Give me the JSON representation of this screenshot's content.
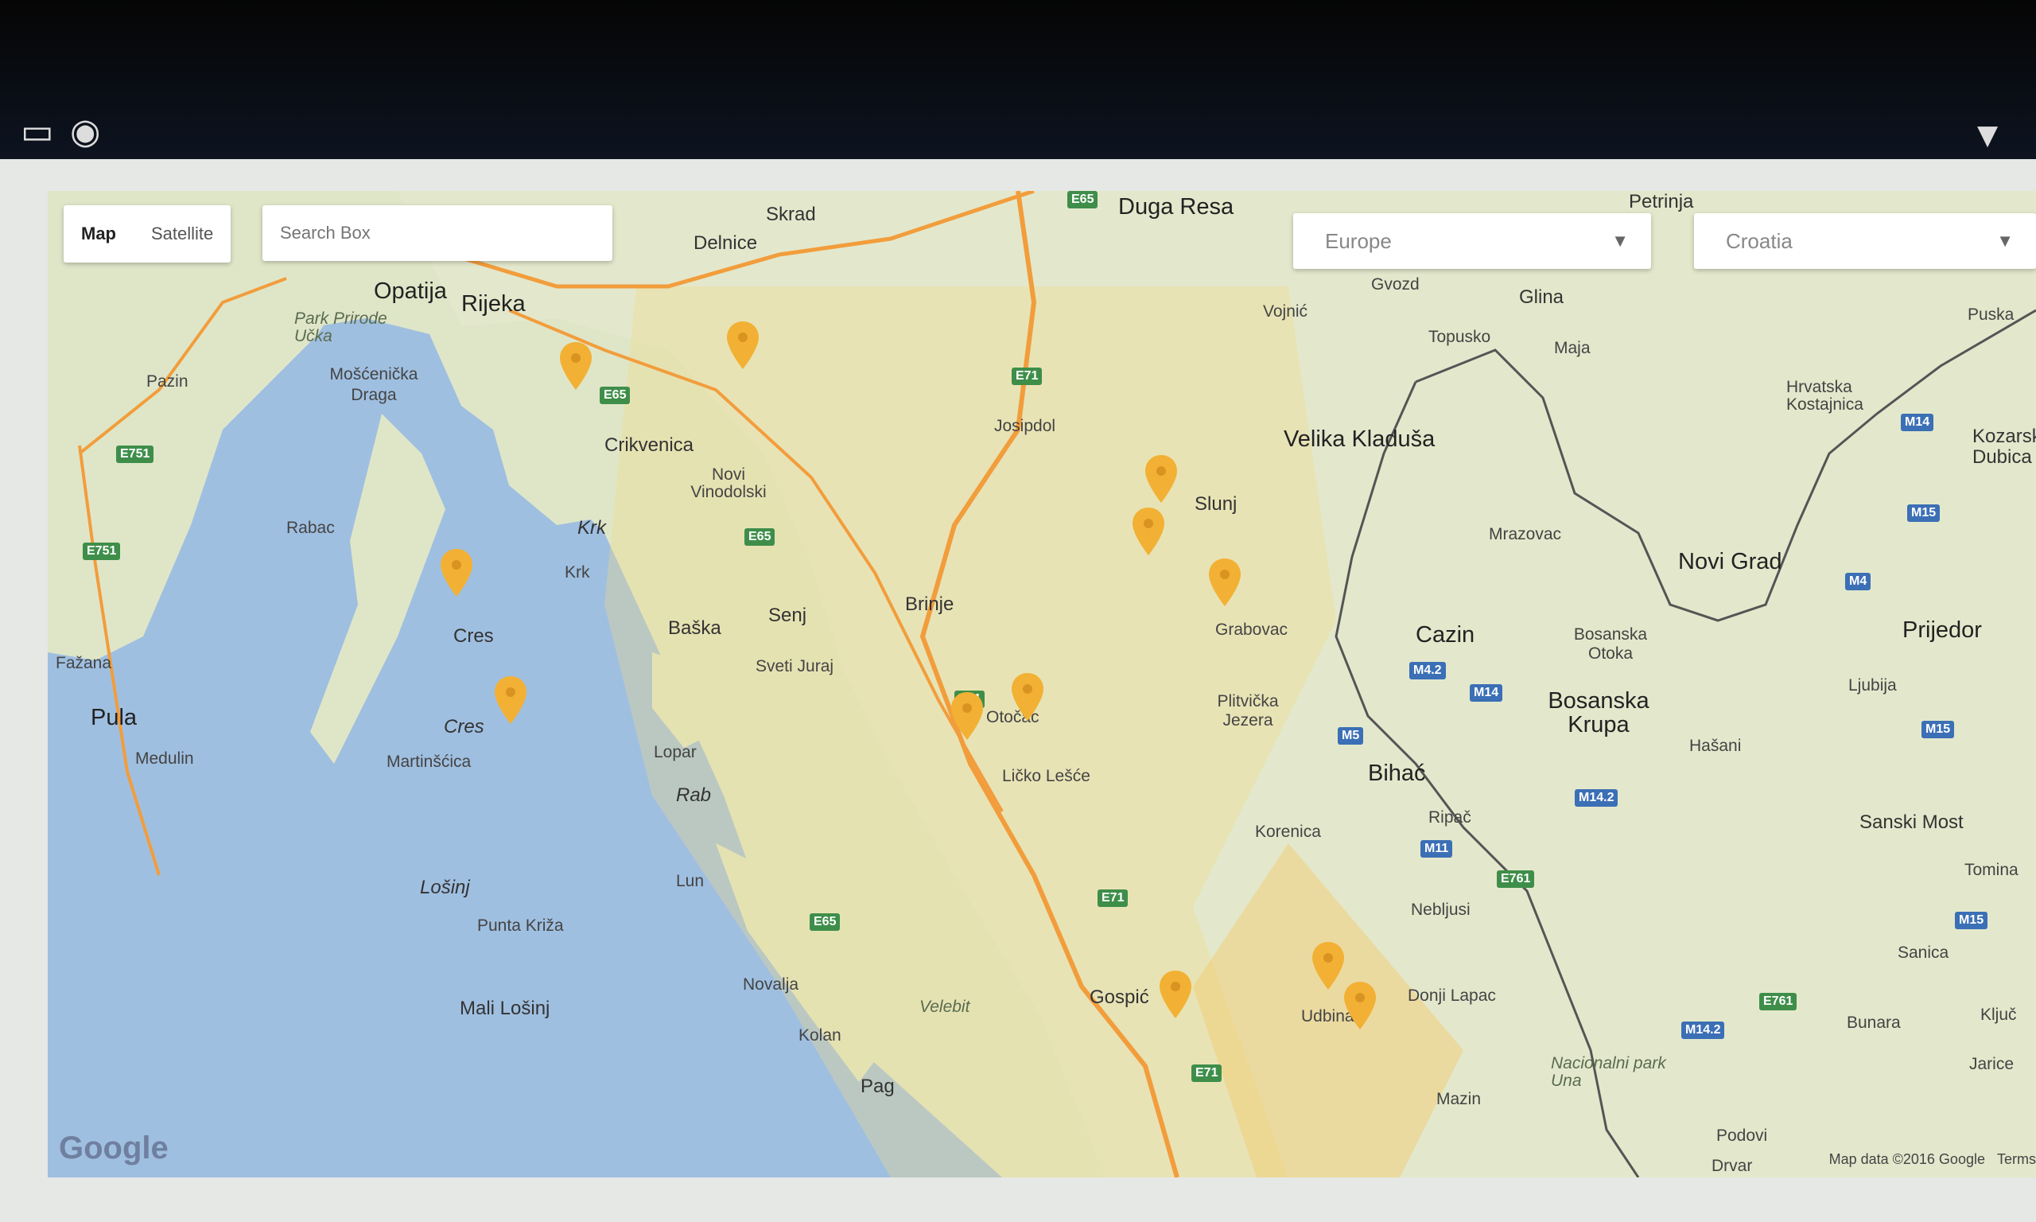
{
  "map_controls": {
    "map_tab": "Map",
    "satellite_tab": "Satellite",
    "search_placeholder": "Search Box",
    "region_select": "Europe",
    "country_select": "Croatia"
  },
  "attribution": {
    "google": "Google",
    "map_data": "Map data ©2016 Google",
    "terms": "Terms"
  },
  "places": {
    "skrad": "Skrad",
    "duga_resa": "Duga Resa",
    "petrinja": "Petrinja",
    "delnice": "Delnice",
    "opatija": "Opatija",
    "rijeka": "Rijeka",
    "park_ucka": "Park Prirode Učka",
    "moscenicka": "Mošćenička Draga",
    "gvozd": "Gvozd",
    "glina": "Glina",
    "vojnic": "Vojnić",
    "topusko": "Topusko",
    "maja": "Maja",
    "puska": "Puska",
    "pazin": "Pazin",
    "josipdol": "Josipdol",
    "hrvatska_kostajnica": "Hrvatska Kostajnica",
    "kozarska": "Kozarska Dubica",
    "crikvenica": "Crikvenica",
    "novi_vinodolski": "Novi Vinodolski",
    "velika_kladusa": "Velika Kladuša",
    "slunj": "Slunj",
    "rabac": "Rabac",
    "krk_island": "Krk",
    "krk_town": "Krk",
    "mrazovac": "Mrazovac",
    "novi_grad": "Novi Grad",
    "senj": "Senj",
    "brinje": "Brinje",
    "grabovac": "Grabovac",
    "cres_town": "Cres",
    "baska": "Baška",
    "cazin": "Cazin",
    "bosanska_otoka": "Bosanska Otoka",
    "prijedor": "Prijedor",
    "fazana": "Fažana",
    "sveti_juraj": "Sveti Juraj",
    "ljubija": "Ljubija",
    "pula": "Pula",
    "plitvicka": "Plitvička Jezera",
    "bosanska_krupa": "Bosanska Krupa",
    "cres_island": "Cres",
    "otocac": "Otočac",
    "medulin": "Medulin",
    "martinscica": "Martinšćica",
    "lopar": "Lopar",
    "hasani": "Hašani",
    "licko_lesce": "Ličko Lešće",
    "bihac": "Bihać",
    "rab": "Rab",
    "ripac": "Ripač",
    "sanski_most": "Sanski Most",
    "korenica": "Korenica",
    "tomina": "Tomina",
    "lun": "Lun",
    "losinj": "Lošinj",
    "nebljusi": "Nebljusi",
    "punta_kriza": "Punta Križa",
    "sanica": "Sanica",
    "novalja": "Novalja",
    "donji_lapac": "Donji Lapac",
    "velebit": "Velebit",
    "gospic": "Gospić",
    "mali_losinj": "Mali Lošinj",
    "udbina": "Udbina",
    "bunara": "Bunara",
    "kljuc": "Ključ",
    "kolan": "Kolan",
    "jarice": "Jarice",
    "np_una": "Nacionalni park Una",
    "pag": "Pag",
    "mazin": "Mazin",
    "podovi": "Podovi",
    "drvar": "Drvar"
  },
  "roads": {
    "e65": "E65",
    "e71": "E71",
    "e751": "E751",
    "e761": "E761",
    "m4": "M4",
    "m42": "M4.2",
    "m14": "M14",
    "m142": "M14.2",
    "m5": "M5",
    "m11": "M11",
    "m15": "M15"
  },
  "colors": {
    "marker": "#f2b134",
    "water": "#9fbfe0",
    "land": "#dfe6c8",
    "border": "#555555"
  }
}
